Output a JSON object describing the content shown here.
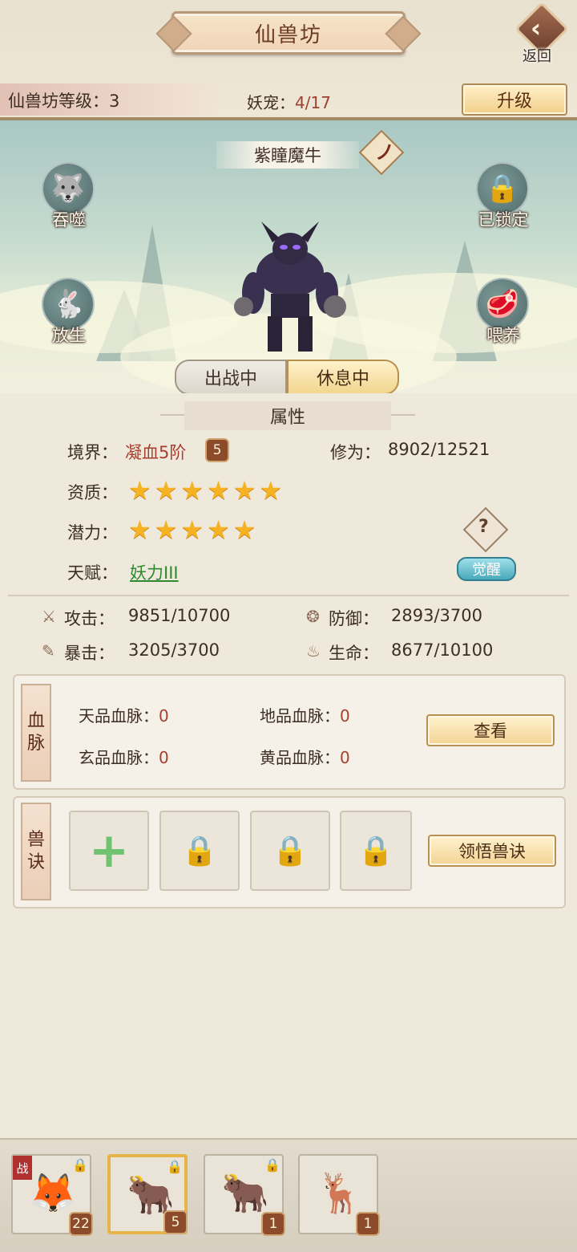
{
  "header": {
    "title": "仙兽坊",
    "back_label": "返回",
    "level_text": "仙兽坊等级：3",
    "pets_label": "妖宠：",
    "pets_value": "4/17",
    "upgrade_label": "升级"
  },
  "pet": {
    "name": "紫瞳魔牛",
    "actions": {
      "devour": "吞噬",
      "release": "放生",
      "locked": "已锁定",
      "feed": "喂养"
    },
    "tabs": {
      "battle": "出战中",
      "rest": "休息中"
    }
  },
  "attributes": {
    "section_title": "属性",
    "realm_label": "境界：",
    "realm_value": "凝血5阶",
    "realm_level": "5",
    "cultivation_label": "修为：",
    "cultivation_value": "8902/12521",
    "aptitude_label": "资质：",
    "aptitude_stars": 6,
    "potential_label": "潜力：",
    "potential_stars": 5,
    "talent_label": "天赋：",
    "talent_value": "妖力III",
    "help_glyph": "?",
    "awaken_label": "觉醒"
  },
  "stats": {
    "attack_label": "攻击：",
    "attack_value": "9851/10700",
    "defense_label": "防御：",
    "defense_value": "2893/3700",
    "crit_label": "暴击：",
    "crit_value": "3205/3700",
    "life_label": "生命：",
    "life_value": "8677/10100"
  },
  "bloodline": {
    "tag_1": "血",
    "tag_2": "脉",
    "heaven_label": "天品血脉：",
    "heaven_value": "0",
    "earth_label": "地品血脉：",
    "earth_value": "0",
    "mystic_label": "玄品血脉：",
    "mystic_value": "0",
    "yellow_label": "黄品血脉：",
    "yellow_value": "0",
    "view_label": "查看"
  },
  "skills": {
    "tag_1": "兽",
    "tag_2": "诀",
    "learn_label": "领悟兽诀"
  },
  "pet_list": [
    {
      "level": "22",
      "battle_tag": "战"
    },
    {
      "level": "5"
    },
    {
      "level": "1"
    },
    {
      "level": "1"
    }
  ]
}
